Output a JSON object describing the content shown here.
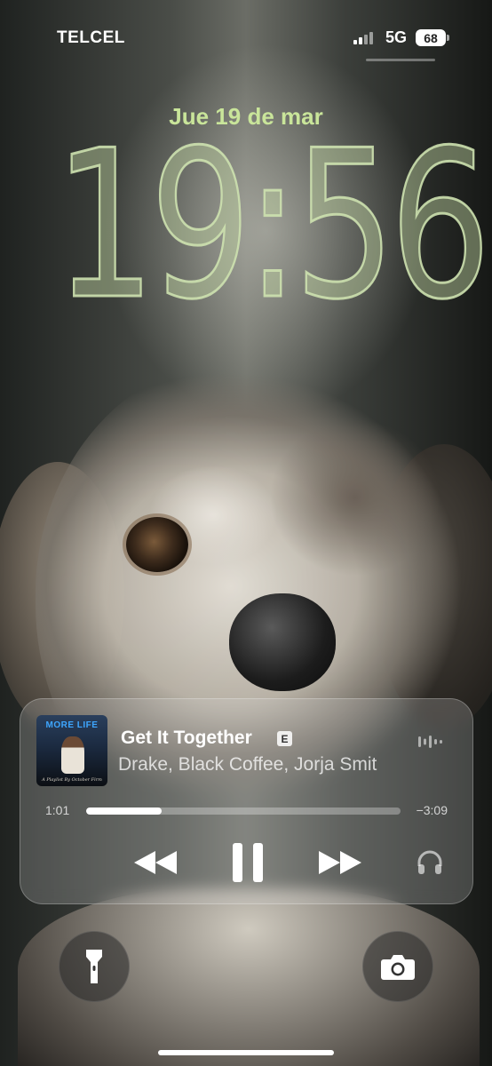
{
  "status_bar": {
    "carrier": "TELCEL",
    "network": "5G",
    "battery": "68",
    "signal_icon": "signal-bars-icon"
  },
  "lock_screen": {
    "date": "Jue 19 de mar",
    "time": "19:56",
    "date_color": "#c9e59a"
  },
  "now_playing": {
    "album_art_text": "MORE LIFE",
    "album_art_subtitle": "A Playlist By October Firm",
    "title": "Get It Together",
    "explicit_badge": "E",
    "artist": "Drake, Black Coffee, Jorja Smit",
    "elapsed": "1:01",
    "remaining": "−3:09",
    "progress_fraction": 0.24,
    "icons": {
      "waveform": "waveform-icon",
      "rewind": "rewind-icon",
      "pause": "pause-icon",
      "forward": "fast-forward-icon",
      "output": "headphones-icon"
    }
  },
  "quick_actions": {
    "left": "flashlight-icon",
    "right": "camera-icon"
  }
}
